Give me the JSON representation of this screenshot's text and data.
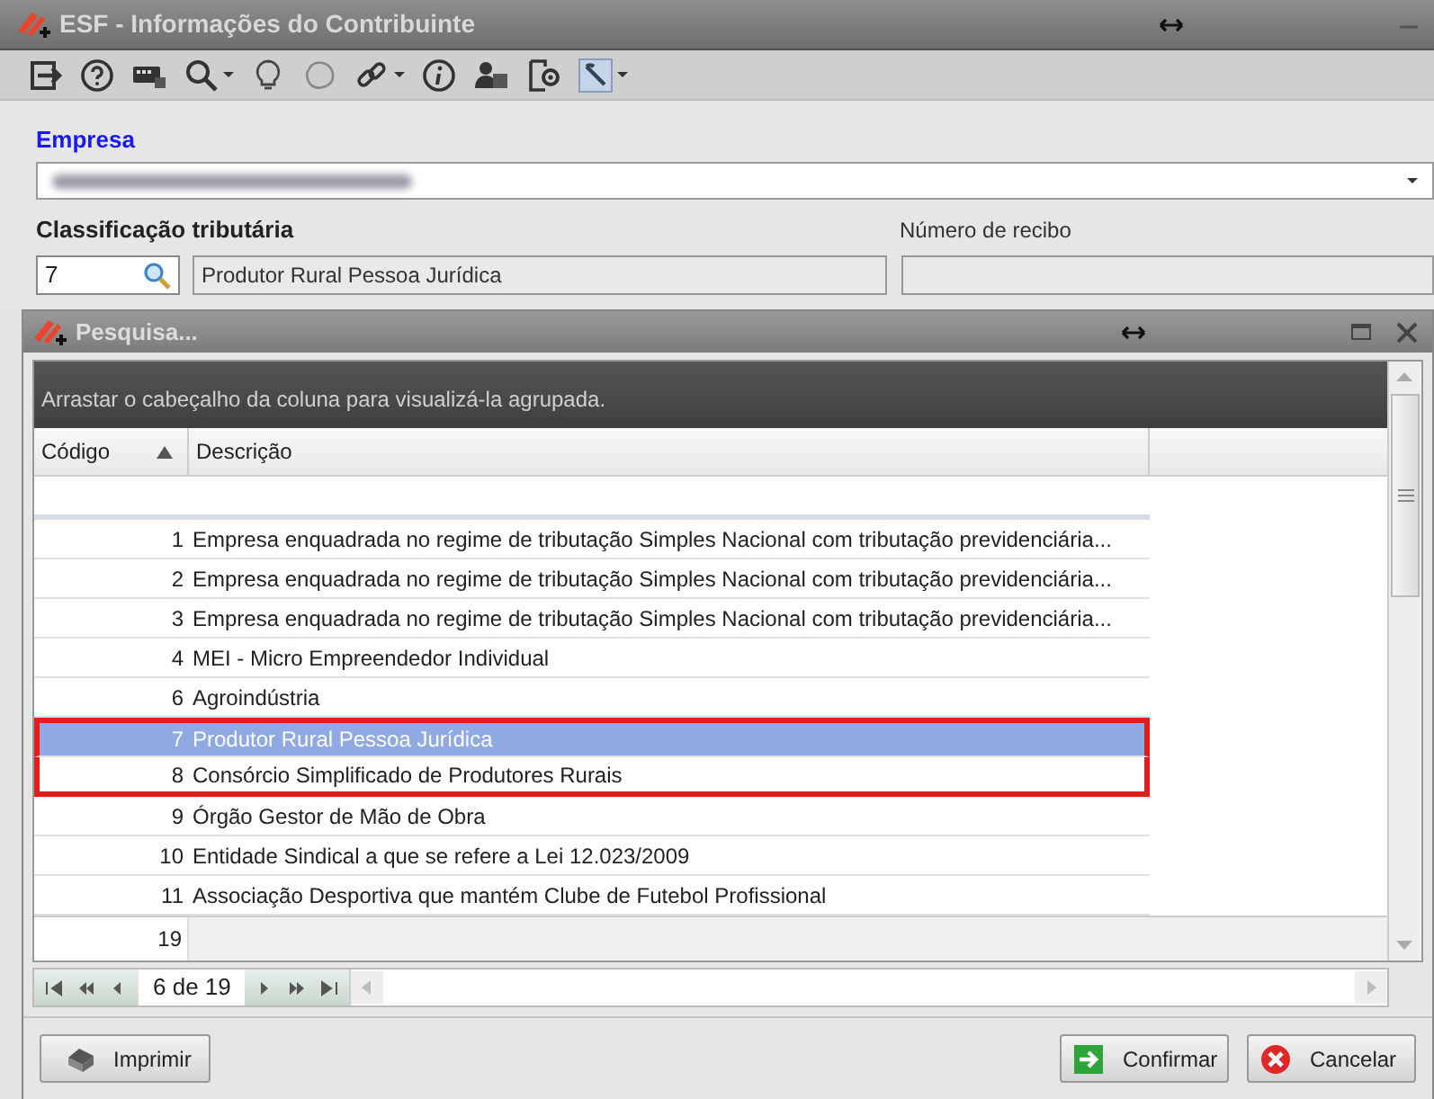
{
  "window": {
    "title": "ESF - Informações do Contribuinte"
  },
  "form": {
    "empresa_label": "Empresa",
    "classificacao_label": "Classificação tributária",
    "classificacao_code": "7",
    "classificacao_description": "Produtor Rural Pessoa Jurídica",
    "recibo_label": "Número de recibo"
  },
  "dialog": {
    "title": "Pesquisa...",
    "group_panel_hint": "Arrastar o cabeçalho da coluna para visualizá-la agrupada.",
    "columns": [
      {
        "label": "Código",
        "sorted": true
      },
      {
        "label": "Descrição",
        "sorted": false
      }
    ],
    "rows": [
      {
        "code": "1",
        "description": "Empresa enquadrada no regime de tributação Simples Nacional com tributação previdenciária...",
        "selected": false,
        "highlighted": false
      },
      {
        "code": "2",
        "description": "Empresa enquadrada no regime de tributação Simples Nacional com tributação previdenciária...",
        "selected": false,
        "highlighted": false
      },
      {
        "code": "3",
        "description": "Empresa enquadrada no regime de tributação Simples Nacional com tributação previdenciária...",
        "selected": false,
        "highlighted": false
      },
      {
        "code": "4",
        "description": "MEI - Micro Empreendedor Individual",
        "selected": false,
        "highlighted": false
      },
      {
        "code": "6",
        "description": "Agroindústria",
        "selected": false,
        "highlighted": false
      },
      {
        "code": "7",
        "description": "Produtor Rural Pessoa Jurídica",
        "selected": true,
        "highlighted": true
      },
      {
        "code": "8",
        "description": "Consórcio Simplificado de Produtores Rurais",
        "selected": false,
        "highlighted": true
      },
      {
        "code": "9",
        "description": "Órgão Gestor de Mão de Obra",
        "selected": false,
        "highlighted": false
      },
      {
        "code": "10",
        "description": "Entidade Sindical a que se refere a Lei 12.023/2009",
        "selected": false,
        "highlighted": false
      },
      {
        "code": "11",
        "description": "Associação Desportiva que mantém Clube de Futebol Profissional",
        "selected": false,
        "highlighted": false
      }
    ],
    "footer_count": "19",
    "navigator": {
      "position": "6 de 19"
    }
  },
  "buttons": [
    {
      "label": "Imprimir",
      "kind": "print"
    },
    {
      "label": "Confirmar",
      "kind": "confirm"
    },
    {
      "label": "Cancelar",
      "kind": "cancel"
    }
  ]
}
